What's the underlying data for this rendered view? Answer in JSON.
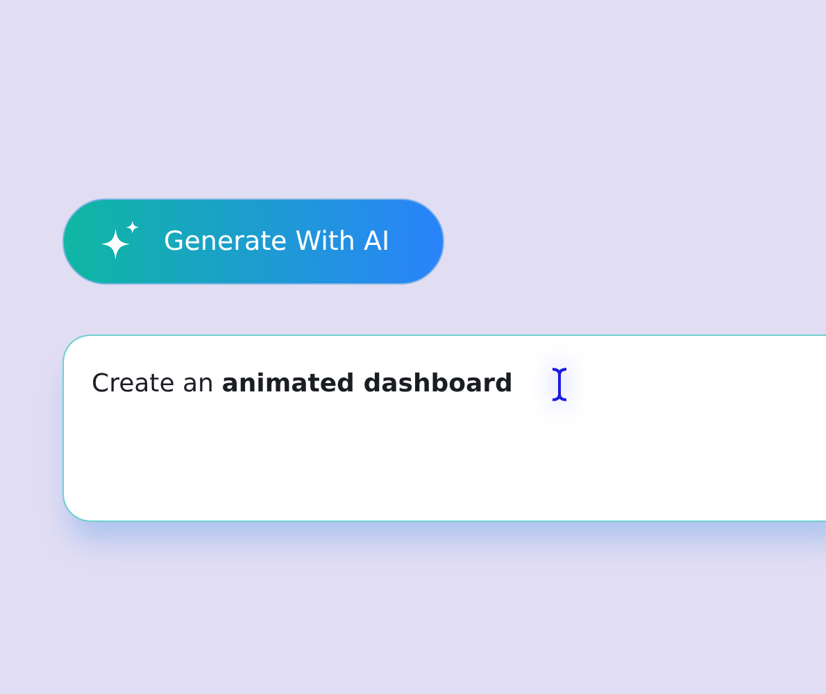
{
  "generate_button": {
    "label": "Generate With AI"
  },
  "prompt_field": {
    "value": "Create an **animated dashboard**"
  }
}
